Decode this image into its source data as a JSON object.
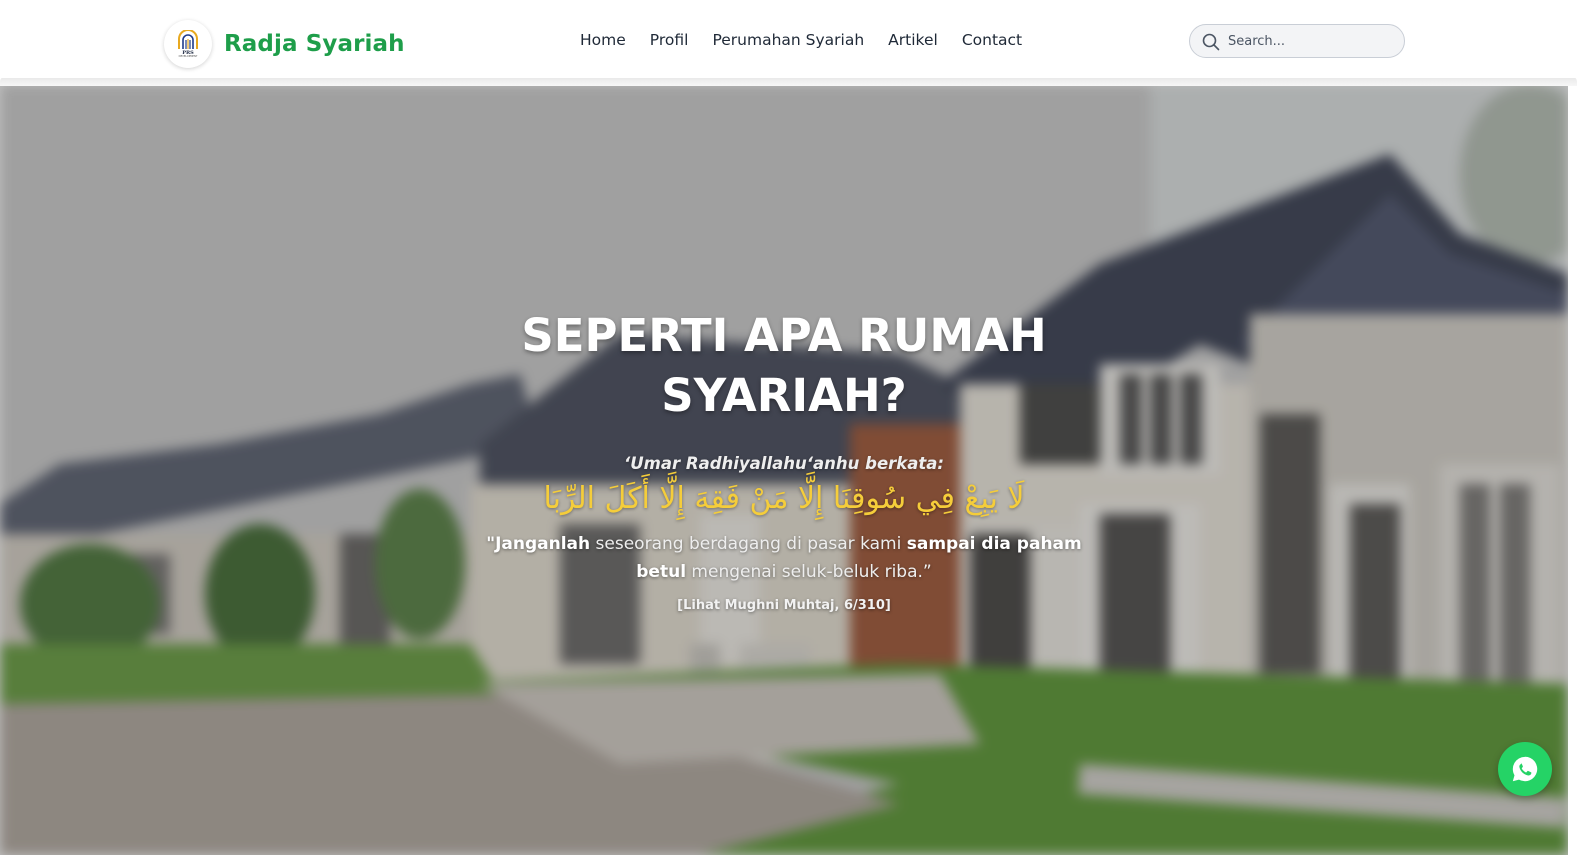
{
  "brand": {
    "name": "Radja Syariah",
    "logo_text": "PRS",
    "logo_subtext": "DEVELOPMENT"
  },
  "nav": {
    "items": [
      {
        "label": "Home"
      },
      {
        "label": "Profil"
      },
      {
        "label": "Perumahan Syariah"
      },
      {
        "label": "Artikel"
      },
      {
        "label": "Contact"
      }
    ]
  },
  "search": {
    "placeholder": "Search...",
    "icon": "search-icon"
  },
  "hero": {
    "title_line1": "SEPERTI APA RUMAH",
    "title_line2": "SYARIAH?",
    "quote_intro": "‘Umar Radhiyallahu‘anhu berkata:",
    "arabic": "لَا يَبِعْ فِي سُوقِنَا إِلَّا مَنْ فَقِهَ إِلَّا أَكَلَ الرِّبَا",
    "translation_parts": [
      {
        "text": "\"Janganlah",
        "bold": true
      },
      {
        "text": " seseorang berdagang di pasar kami ",
        "bold": false
      },
      {
        "text": "sampai dia paham betul",
        "bold": true
      },
      {
        "text": " mengenai seluk-beluk riba.”",
        "bold": false
      }
    ],
    "source": "[Lihat Mughni Muhtaj, 6/310]",
    "background": "blurred row of houses"
  },
  "whatsapp": {
    "icon": "whatsapp-icon",
    "color": "#25d366"
  },
  "colors": {
    "brand_green": "#1e9e4a",
    "arabic_gold": "#f5cd3a"
  }
}
